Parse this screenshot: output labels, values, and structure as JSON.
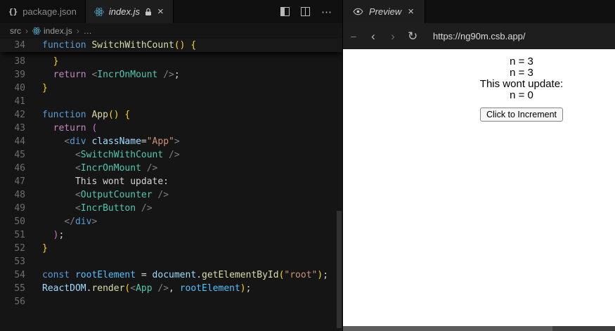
{
  "colors": {
    "react_blue": "#59b7d9",
    "editor_bg": "#151515",
    "tokens": {
      "kw": "#569cd6",
      "fn": "#dcdcaa",
      "comp": "#4ec9b0",
      "attr": "#9cdcfe",
      "str": "#ce9178",
      "ctrl": "#c586c0",
      "pl": "#d4d4d4",
      "pu": "#808080",
      "b1": "#ffd700",
      "b2": "#da70d6",
      "var": "#4fc1ff"
    }
  },
  "icons": {
    "json_glyph": "{}",
    "close_glyph": "×",
    "ellipsis_glyph": "⋯",
    "back_glyph": "‹",
    "forward_glyph": "›",
    "refresh_glyph": "↻",
    "dash_glyph": "–"
  },
  "editor": {
    "tabs": [
      {
        "label": "package.json"
      },
      {
        "label": "index.js"
      }
    ],
    "breadcrumb": {
      "items": [
        "src",
        "index.js",
        "…"
      ],
      "separator": "›"
    },
    "sticky_line": {
      "num": "34",
      "segs": [
        [
          "function",
          "kw"
        ],
        [
          " ",
          "pl"
        ],
        [
          "SwitchWithCount",
          "fn"
        ],
        [
          "()",
          "b1"
        ],
        [
          " ",
          "pl"
        ],
        [
          "{",
          "b1"
        ]
      ]
    },
    "lines": [
      {
        "num": "38",
        "segs": [
          [
            "  }",
            "b1"
          ]
        ]
      },
      {
        "num": "39",
        "segs": [
          [
            "  ",
            "pl"
          ],
          [
            "return",
            "ctrl"
          ],
          [
            " ",
            "pl"
          ],
          [
            "<",
            "pu"
          ],
          [
            "IncrOnMount",
            "comp"
          ],
          [
            " ",
            "pl"
          ],
          [
            "/>",
            "pu"
          ],
          [
            ";",
            "pl"
          ]
        ]
      },
      {
        "num": "40",
        "segs": [
          [
            "}",
            "b1"
          ]
        ]
      },
      {
        "num": "41",
        "segs": []
      },
      {
        "num": "42",
        "segs": [
          [
            "function",
            "kw"
          ],
          [
            " ",
            "pl"
          ],
          [
            "App",
            "fn"
          ],
          [
            "()",
            "b1"
          ],
          [
            " ",
            "pl"
          ],
          [
            "{",
            "b1"
          ]
        ]
      },
      {
        "num": "43",
        "segs": [
          [
            "  ",
            "pl"
          ],
          [
            "return",
            "ctrl"
          ],
          [
            " ",
            "pl"
          ],
          [
            "(",
            "b2"
          ]
        ]
      },
      {
        "num": "44",
        "segs": [
          [
            "    ",
            "pl"
          ],
          [
            "<",
            "pu"
          ],
          [
            "div",
            "kw"
          ],
          [
            " ",
            "pl"
          ],
          [
            "className",
            "attr"
          ],
          [
            "=",
            "pl"
          ],
          [
            "\"App\"",
            "str"
          ],
          [
            ">",
            "pu"
          ]
        ]
      },
      {
        "num": "45",
        "segs": [
          [
            "      ",
            "pl"
          ],
          [
            "<",
            "pu"
          ],
          [
            "SwitchWithCount",
            "comp"
          ],
          [
            " ",
            "pl"
          ],
          [
            "/>",
            "pu"
          ]
        ]
      },
      {
        "num": "46",
        "segs": [
          [
            "      ",
            "pl"
          ],
          [
            "<",
            "pu"
          ],
          [
            "IncrOnMount",
            "comp"
          ],
          [
            " ",
            "pl"
          ],
          [
            "/>",
            "pu"
          ]
        ]
      },
      {
        "num": "47",
        "segs": [
          [
            "      This wont update:",
            "pl"
          ]
        ]
      },
      {
        "num": "48",
        "segs": [
          [
            "      ",
            "pl"
          ],
          [
            "<",
            "pu"
          ],
          [
            "OutputCounter",
            "comp"
          ],
          [
            " ",
            "pl"
          ],
          [
            "/>",
            "pu"
          ]
        ]
      },
      {
        "num": "49",
        "segs": [
          [
            "      ",
            "pl"
          ],
          [
            "<",
            "pu"
          ],
          [
            "IncrButton",
            "comp"
          ],
          [
            " ",
            "pl"
          ],
          [
            "/>",
            "pu"
          ]
        ]
      },
      {
        "num": "50",
        "segs": [
          [
            "    ",
            "pl"
          ],
          [
            "</",
            "pu"
          ],
          [
            "div",
            "kw"
          ],
          [
            ">",
            "pu"
          ]
        ]
      },
      {
        "num": "51",
        "segs": [
          [
            "  ",
            "pl"
          ],
          [
            ")",
            "b2"
          ],
          [
            ";",
            "pl"
          ]
        ]
      },
      {
        "num": "52",
        "segs": [
          [
            "}",
            "b1"
          ]
        ]
      },
      {
        "num": "53",
        "segs": []
      },
      {
        "num": "54",
        "segs": [
          [
            "const",
            "kw"
          ],
          [
            " ",
            "pl"
          ],
          [
            "rootElement",
            "var"
          ],
          [
            " ",
            "pl"
          ],
          [
            "=",
            "pl"
          ],
          [
            " ",
            "pl"
          ],
          [
            "document",
            "attr"
          ],
          [
            ".",
            "pl"
          ],
          [
            "getElementById",
            "fn"
          ],
          [
            "(",
            "b1"
          ],
          [
            "\"root\"",
            "str"
          ],
          [
            ")",
            "b1"
          ],
          [
            ";",
            "pl"
          ]
        ]
      },
      {
        "num": "55",
        "segs": [
          [
            "ReactDOM",
            "attr"
          ],
          [
            ".",
            "pl"
          ],
          [
            "render",
            "fn"
          ],
          [
            "(",
            "b1"
          ],
          [
            "<",
            "pu"
          ],
          [
            "App",
            "comp"
          ],
          [
            " ",
            "pl"
          ],
          [
            "/>",
            "pu"
          ],
          [
            ",",
            "pl"
          ],
          [
            " ",
            "pl"
          ],
          [
            "rootElement",
            "var"
          ],
          [
            ")",
            "b1"
          ],
          [
            ";",
            "pl"
          ]
        ]
      },
      {
        "num": "56",
        "segs": []
      }
    ]
  },
  "preview": {
    "tab_label": "Preview",
    "nav": {
      "url": "https://ng90m.csb.app/"
    },
    "output_lines": [
      "n = 3",
      "n = 3",
      "This wont update:",
      "n = 0"
    ],
    "button_label": "Click to Increment"
  }
}
